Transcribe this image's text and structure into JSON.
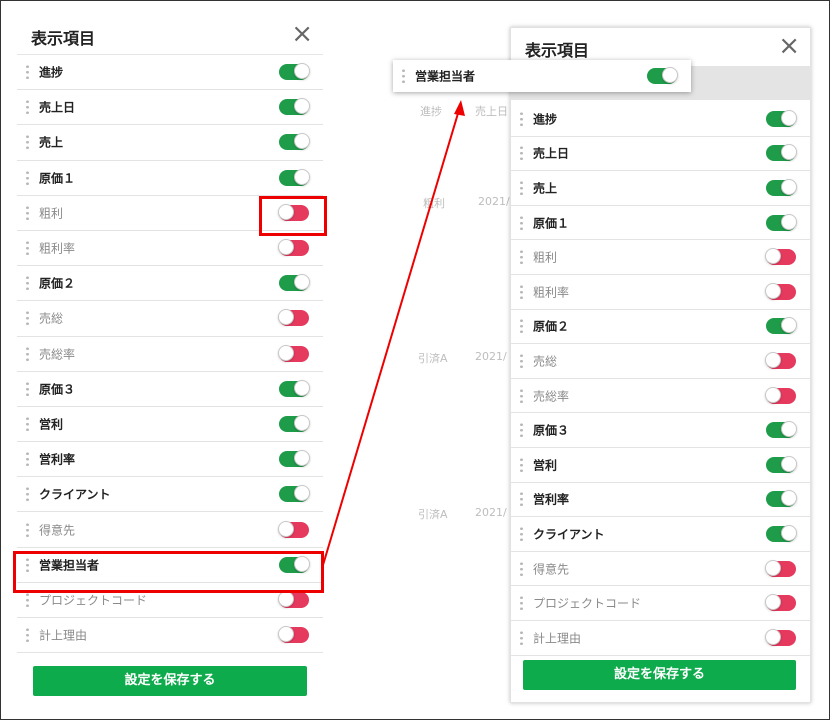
{
  "panel": {
    "title": "表示項目",
    "close_icon": "×",
    "save_label": "設定を保存する"
  },
  "colors": {
    "toggle_on": "#1f9c49",
    "toggle_off": "#e6395e",
    "save_button": "#0eab4c",
    "highlight": "#ee0000"
  },
  "left_items": [
    {
      "label": "進捗",
      "on": true
    },
    {
      "label": "売上日",
      "on": true
    },
    {
      "label": "売上",
      "on": true
    },
    {
      "label": "原価１",
      "on": true
    },
    {
      "label": "粗利",
      "on": false
    },
    {
      "label": "粗利率",
      "on": false
    },
    {
      "label": "原価２",
      "on": true
    },
    {
      "label": "売総",
      "on": false
    },
    {
      "label": "売総率",
      "on": false
    },
    {
      "label": "原価３",
      "on": true
    },
    {
      "label": "営利",
      "on": true
    },
    {
      "label": "営利率",
      "on": true
    },
    {
      "label": "クライアント",
      "on": true
    },
    {
      "label": "得意先",
      "on": false
    },
    {
      "label": "営業担当者",
      "on": true
    },
    {
      "label": "プロジェクトコード",
      "on": false
    },
    {
      "label": "計上理由",
      "on": false
    }
  ],
  "right_items": [
    {
      "label": "進捗",
      "on": true
    },
    {
      "label": "売上日",
      "on": true
    },
    {
      "label": "売上",
      "on": true
    },
    {
      "label": "原価１",
      "on": true
    },
    {
      "label": "粗利",
      "on": false
    },
    {
      "label": "粗利率",
      "on": false
    },
    {
      "label": "原価２",
      "on": true
    },
    {
      "label": "売総",
      "on": false
    },
    {
      "label": "売総率",
      "on": false
    },
    {
      "label": "原価３",
      "on": true
    },
    {
      "label": "営利",
      "on": true
    },
    {
      "label": "営利率",
      "on": true
    },
    {
      "label": "クライアント",
      "on": true
    },
    {
      "label": "得意先",
      "on": false
    },
    {
      "label": "プロジェクトコード",
      "on": false
    },
    {
      "label": "計上理由",
      "on": false
    }
  ],
  "dragging_item": {
    "label": "営業担当者",
    "on": true
  },
  "background_ghost": {
    "header1": "進捗",
    "header2": "売上日",
    "cells": [
      "粗利",
      "2021/",
      "引済A",
      "2021/",
      "引済A",
      "2021/"
    ]
  }
}
